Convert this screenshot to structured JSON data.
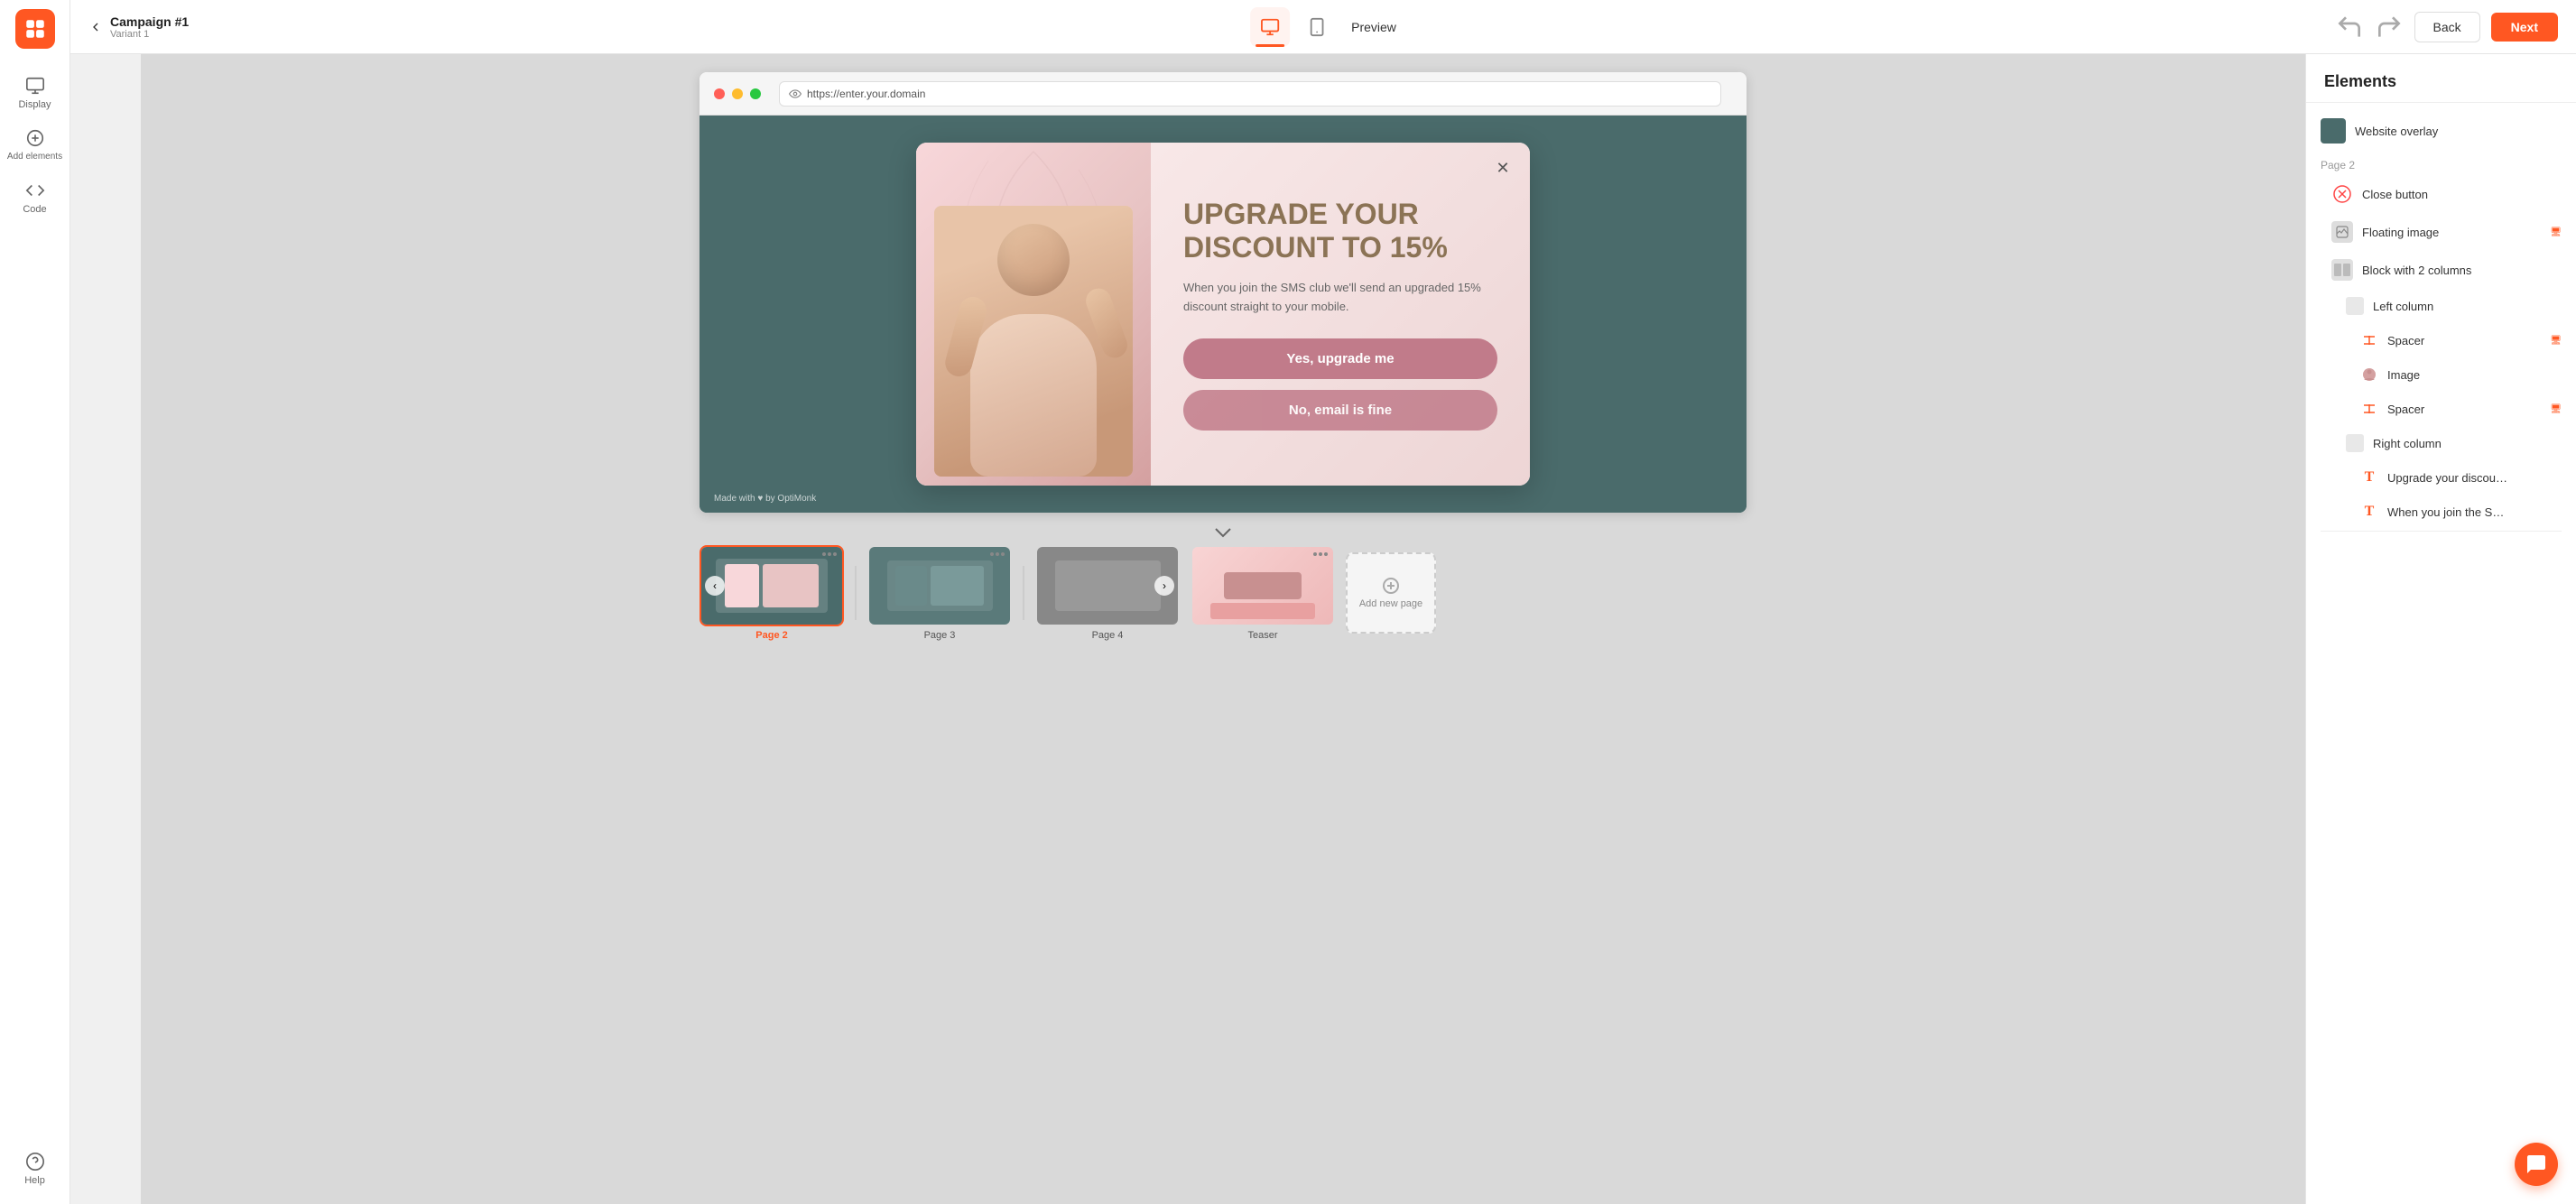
{
  "topbar": {
    "campaign_title": "Campaign #1",
    "variant": "Variant 1",
    "preview_label": "Preview",
    "back_label": "Back",
    "next_label": "Next"
  },
  "sidebar": {
    "display_label": "Display",
    "add_elements_label": "Add elements",
    "code_label": "Code",
    "help_label": "Help"
  },
  "browser": {
    "url": "https://enter.your.domain"
  },
  "popup": {
    "heading": "UPGRADE YOUR DISCOUNT TO 15%",
    "body_text": "When you join the SMS club we'll send an upgraded 15% discount straight to your mobile.",
    "btn_primary": "Yes, upgrade me",
    "btn_secondary": "No, email is fine",
    "made_with": "Made with ♥ by OptiMonk"
  },
  "pages": [
    {
      "label": "Page 2",
      "active": true
    },
    {
      "label": "Page 3",
      "active": false
    },
    {
      "label": "Page 4",
      "active": false
    },
    {
      "label": "Teaser",
      "active": false
    }
  ],
  "add_page_label": "Add new page",
  "right_panel": {
    "title": "Elements",
    "page2_label": "Page 2",
    "items": [
      {
        "label": "Website overlay",
        "indent": 0,
        "icon_type": "dark-green",
        "monitor": false
      },
      {
        "label": "Close button",
        "indent": 1,
        "icon_type": "close-red",
        "monitor": false
      },
      {
        "label": "Floating image",
        "indent": 1,
        "icon_type": "gray",
        "monitor": true
      },
      {
        "label": "Block with 2 columns",
        "indent": 1,
        "icon_type": "two-col",
        "monitor": false
      },
      {
        "label": "Left column",
        "indent": 2,
        "icon_type": "two-col",
        "monitor": false
      },
      {
        "label": "Spacer",
        "indent": 3,
        "icon_type": "spacer",
        "monitor": true
      },
      {
        "label": "Image",
        "indent": 3,
        "icon_type": "image",
        "monitor": false
      },
      {
        "label": "Spacer",
        "indent": 3,
        "icon_type": "spacer",
        "monitor": true
      },
      {
        "label": "Right column",
        "indent": 2,
        "icon_type": "two-col",
        "monitor": false
      },
      {
        "label": "Upgrade your discou…",
        "indent": 3,
        "icon_type": "text-t",
        "monitor": false
      },
      {
        "label": "When you join the S…",
        "indent": 3,
        "icon_type": "text-t",
        "monitor": false
      }
    ]
  }
}
